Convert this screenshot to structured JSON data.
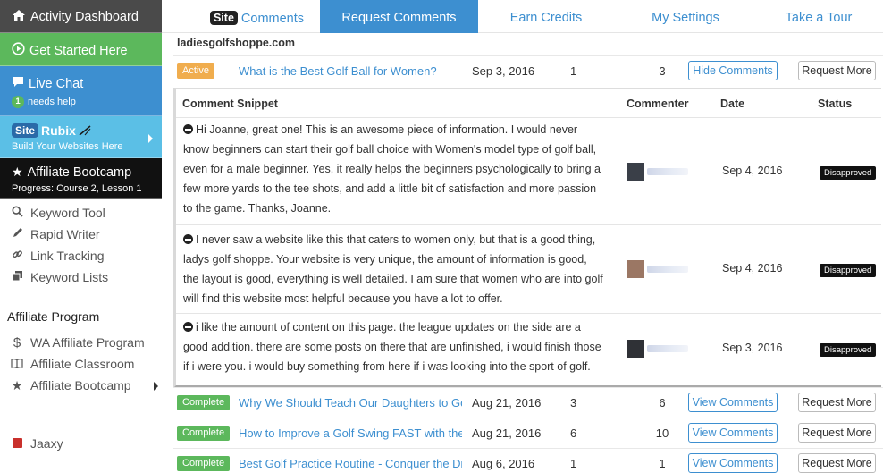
{
  "sidebar": {
    "dashboard": "Activity Dashboard",
    "get_started": "Get Started Here",
    "live_chat": "Live Chat",
    "live_chat_count": "1",
    "live_chat_sub": "needs help",
    "siterubix_site": "Site",
    "siterubix_name": "Rubix",
    "siterubix_sub": "Build Your Websites Here",
    "bootcamp": "Affiliate Bootcamp",
    "bootcamp_progress": "Progress: Course 2, Lesson 1",
    "tools": [
      {
        "label": "Keyword Tool",
        "icon": "search-icon"
      },
      {
        "label": "Rapid Writer",
        "icon": "pencil-icon"
      },
      {
        "label": "Link Tracking",
        "icon": "link-icon"
      },
      {
        "label": "Keyword Lists",
        "icon": "copy-icon"
      }
    ],
    "affiliate_heading": "Affiliate Program",
    "affiliate_items": [
      {
        "label": "WA Affiliate Program",
        "icon": "dollar-icon"
      },
      {
        "label": "Affiliate Classroom",
        "icon": "book-icon"
      },
      {
        "label": "Affiliate Bootcamp",
        "icon": "star-icon"
      }
    ],
    "jaaxy": "Jaaxy"
  },
  "tabs": {
    "site_pill": "Site",
    "comments": "Comments",
    "request_comments": "Request Comments",
    "earn_credits": "Earn Credits",
    "my_settings": "My Settings",
    "take_tour": "Take a Tour"
  },
  "domain": "ladiesgolfshoppe.com",
  "active_row": {
    "status": "Active",
    "title": "What is the Best Golf Ball for Women?",
    "date": "Sep 3, 2016",
    "n1": "1",
    "n2": "3",
    "primary_button": "Hide Comments",
    "secondary_button": "Request More"
  },
  "comments_panel": {
    "headers": {
      "snippet": "Comment Snippet",
      "commenter": "Commenter",
      "date": "Date",
      "status": "Status"
    },
    "comments": [
      {
        "text": "Hi Joanne, great one! This is an awesome piece of information. I would never know beginners can start their golf ball choice with Women's model type of golf ball, even for a male beginner. Yes, it really helps the beginners psychologically to bring a few more yards to the tee shots, and add a little bit of satisfaction and more passion to the game. Thanks, Joanne.",
        "date": "Sep 4, 2016",
        "status": "Disapproved",
        "avatar_color": "#3a3f48"
      },
      {
        "text": "I never saw a website like this that caters to women only, but that is a good thing, ladys golf shoppe. Your website is very unique, the amount of information is good, the layout is good, everything is well detailed. I am sure that women who are into golf will find this website most helpful because you have a lot to offer.",
        "date": "Sep 4, 2016",
        "status": "Disapproved",
        "avatar_color": "#9b7764"
      },
      {
        "text": "i like the amount of content on this page. the league updates on the side are a good addition. there are some posts on there that are unfinished, i would finish those if i were you. i would buy something from here if i was looking into the sport of golf.",
        "date": "Sep 3, 2016",
        "status": "Disapproved",
        "avatar_color": "#2f3136"
      }
    ]
  },
  "rows": [
    {
      "status": "Complete",
      "title": "Why We Should Teach Our Daughters to Golf -",
      "date": "Aug 21, 2016",
      "n1": "3",
      "n2": "6",
      "primary_button": "View Comments",
      "secondary_button": "Request More"
    },
    {
      "status": "Complete",
      "title": "How to Improve a Golf Swing FAST with the Pl",
      "date": "Aug 21, 2016",
      "n1": "6",
      "n2": "10",
      "primary_button": "View Comments",
      "secondary_button": "Request More"
    },
    {
      "status": "Complete",
      "title": "Best Golf Practice Routine - Conquer the Drivir",
      "date": "Aug 6, 2016",
      "n1": "1",
      "n2": "1",
      "primary_button": "View Comments",
      "secondary_button": "Request More"
    }
  ],
  "colors": {
    "primary_blue": "#3d8fd0",
    "green": "#5cb85c",
    "orange": "#f0ad4e",
    "dark": "#111111"
  }
}
